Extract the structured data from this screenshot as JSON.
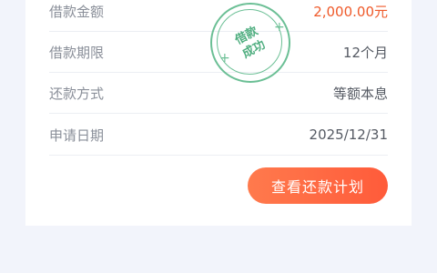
{
  "loan": {
    "rows": [
      {
        "label": "借款金额",
        "value": "2,000.00",
        "unit": "元"
      },
      {
        "label": "借款期限",
        "value": "12个月"
      },
      {
        "label": "还款方式",
        "value": "等额本息"
      },
      {
        "label": "申请日期",
        "value": "2025/12/31"
      }
    ]
  },
  "stamp": {
    "line1": "借款",
    "line2": "成功",
    "color": "#3ea673"
  },
  "actions": {
    "view_plan_label": "查看还款计划"
  },
  "colors": {
    "accent": "#ef5a2a",
    "button_start": "#ff7a4d",
    "button_end": "#ff5b3a"
  }
}
